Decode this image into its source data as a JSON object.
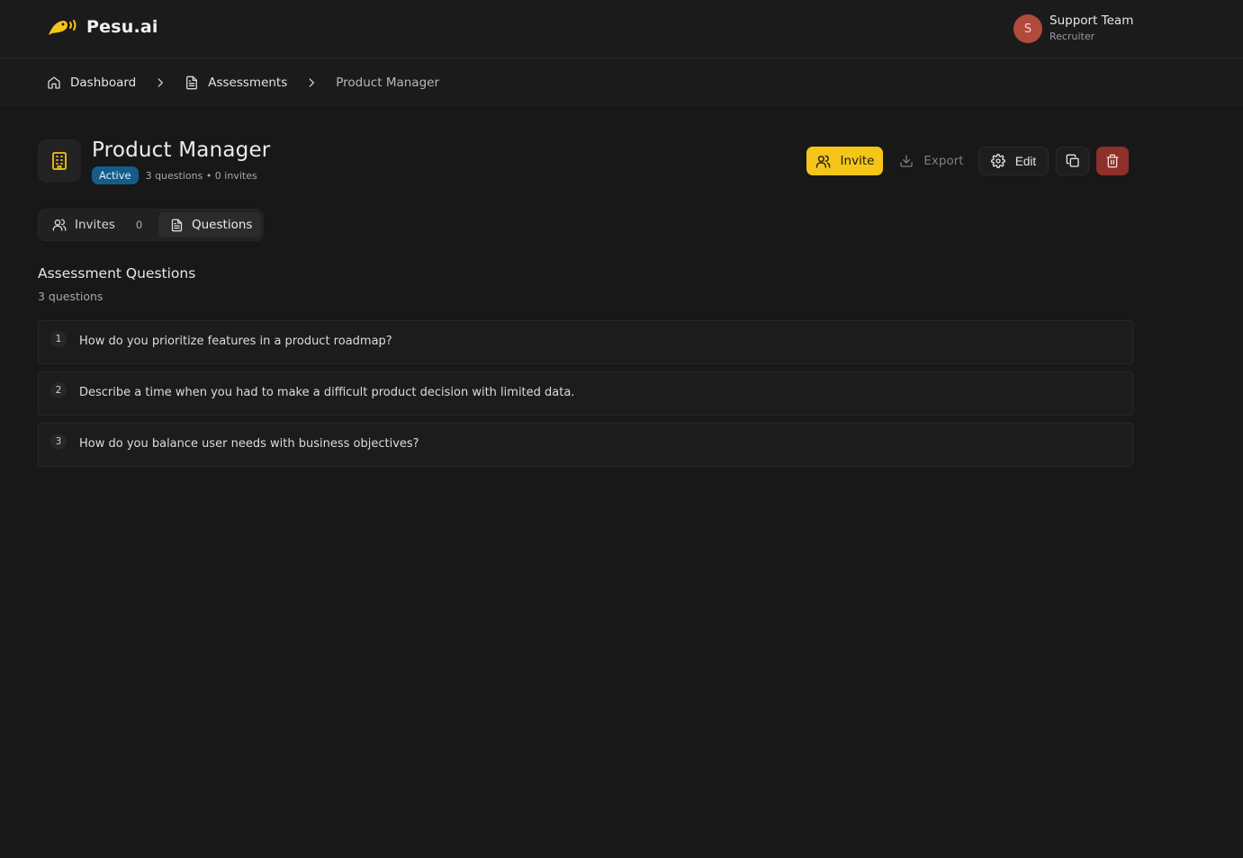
{
  "app": {
    "brand": "Pesu.ai"
  },
  "user": {
    "initial": "S",
    "name": "Support Team",
    "role": "Recruiter"
  },
  "breadcrumb": [
    {
      "label": "Dashboard",
      "icon": "home-icon"
    },
    {
      "label": "Assessments",
      "icon": "document-icon"
    },
    {
      "label": "Product Manager"
    }
  ],
  "assessment": {
    "title": "Product Manager",
    "status": "Active",
    "meta": "3 questions • 0 invites",
    "icon": "building-icon"
  },
  "actions": {
    "invite": "Invite",
    "export": "Export",
    "edit": "Edit"
  },
  "tabs": {
    "invites": {
      "label": "Invites",
      "count": "0"
    },
    "questions": {
      "label": "Questions"
    }
  },
  "section": {
    "title": "Assessment Questions",
    "subtitle": "3 questions"
  },
  "questions": [
    {
      "num": "1",
      "text": "How do you prioritize features in a product roadmap?"
    },
    {
      "num": "2",
      "text": "Describe a time when you had to make a difficult product decision with limited data."
    },
    {
      "num": "3",
      "text": "How do you balance user needs with business objectives?"
    }
  ],
  "colors": {
    "background": "#181818",
    "accent": "#f5c518",
    "status_active": "#155c8a",
    "danger": "#8d2f2a",
    "avatar": "#b04a3a"
  }
}
